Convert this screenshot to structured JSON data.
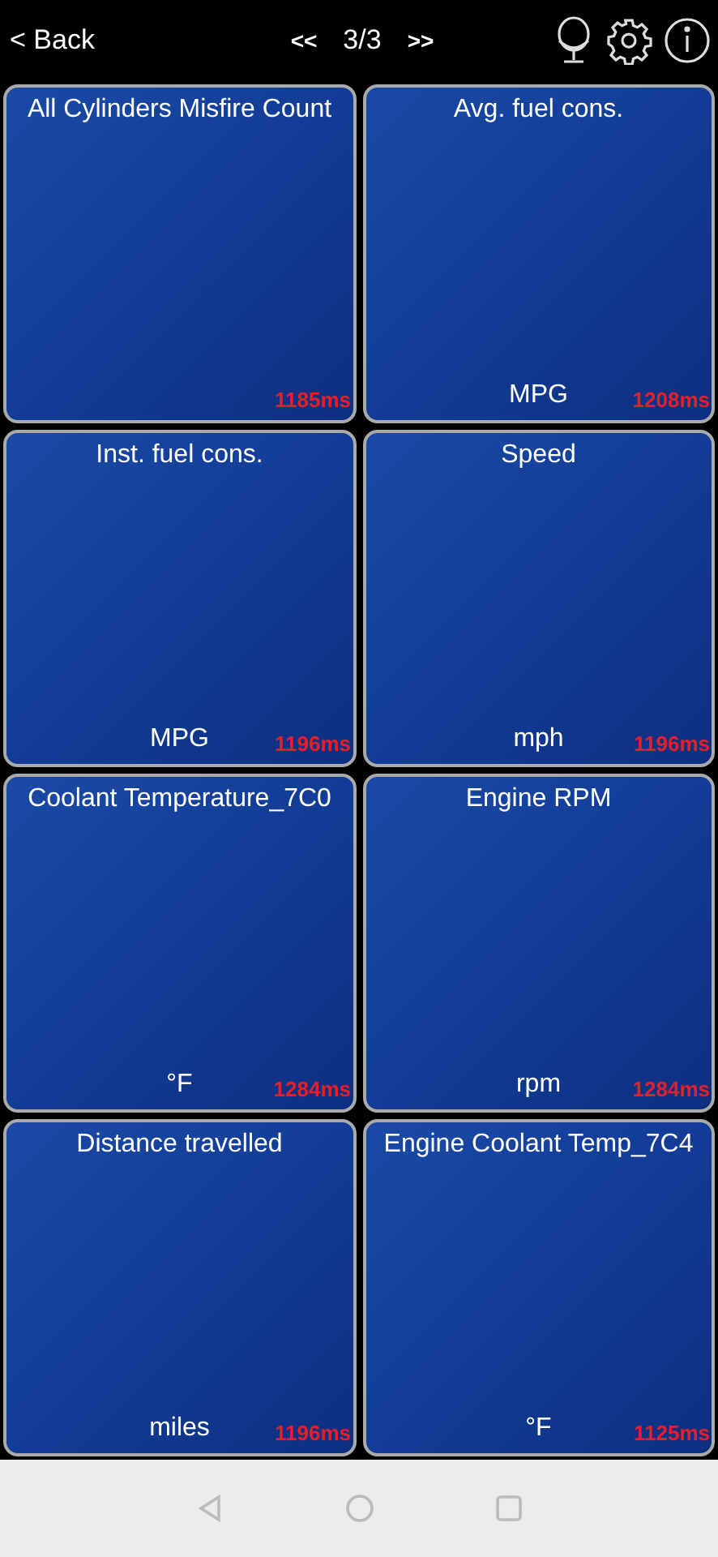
{
  "top_bar": {
    "back": "< Back",
    "prev": "<<",
    "page": "3/3",
    "next": ">>"
  },
  "tiles": [
    {
      "title": "All Cylinders Misfire Count",
      "timing": "1185ms"
    },
    {
      "title": "Avg. fuel cons.",
      "unit": "MPG",
      "timing": "1208ms"
    },
    {
      "title": "Inst. fuel cons.",
      "unit": "MPG",
      "timing": "1196ms"
    },
    {
      "title": "Speed",
      "unit": "mph",
      "timing": "1196ms"
    },
    {
      "title": "Coolant Temperature_7C0",
      "unit": "°F",
      "timing": "1284ms"
    },
    {
      "title": "Engine RPM",
      "unit": "rpm",
      "timing": "1284ms"
    },
    {
      "title": "Distance travelled",
      "unit": "miles",
      "timing": "1196ms"
    },
    {
      "title": "Engine Coolant Temp_7C4",
      "unit": "°F",
      "timing": "1125ms"
    }
  ]
}
